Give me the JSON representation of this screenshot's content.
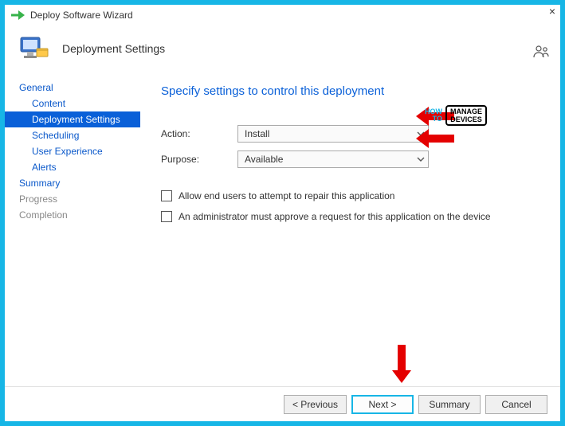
{
  "window": {
    "title": "Deploy Software Wizard"
  },
  "header": {
    "title": "Deployment Settings"
  },
  "sidebar": {
    "groups": [
      {
        "label": "General",
        "type": "group"
      },
      {
        "label": "Content",
        "type": "item"
      },
      {
        "label": "Deployment Settings",
        "type": "item",
        "selected": true
      },
      {
        "label": "Scheduling",
        "type": "item"
      },
      {
        "label": "User Experience",
        "type": "item"
      },
      {
        "label": "Alerts",
        "type": "item"
      },
      {
        "label": "Summary",
        "type": "group"
      },
      {
        "label": "Progress",
        "type": "disabled"
      },
      {
        "label": "Completion",
        "type": "disabled"
      }
    ]
  },
  "content": {
    "heading": "Specify settings to control this deployment",
    "action": {
      "label": "Action:",
      "value": "Install"
    },
    "purpose": {
      "label": "Purpose:",
      "value": "Available"
    },
    "checkbox1": {
      "label": "Allow end users to attempt to repair this application",
      "checked": false
    },
    "checkbox2": {
      "label": "An administrator must approve a request for this application on the device",
      "checked": false
    }
  },
  "footer": {
    "previous": "< Previous",
    "next": "Next >",
    "summary": "Summary",
    "cancel": "Cancel"
  },
  "watermark": {
    "howto": "HOW\nTO",
    "manage": "MANAGE",
    "devices": "DEVICES"
  }
}
